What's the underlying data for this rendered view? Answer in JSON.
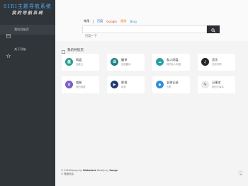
{
  "sidebar": {
    "logo_line1": "SIRI主题导航系统",
    "logo_line2": "我的导航系统",
    "items": [
      {
        "label": "我的导航页"
      },
      {
        "label": "关于导航"
      }
    ]
  },
  "search": {
    "tabs": [
      {
        "label": "常用",
        "color": "#333333"
      },
      {
        "label": "百度",
        "color": "#2d63de"
      },
      {
        "label": "Google",
        "color": "#d9534f"
      },
      {
        "label": "搜狗",
        "color": "#e8821c"
      },
      {
        "label": "Bing",
        "color": "#3ba0d8"
      }
    ],
    "placeholder": "百度一下",
    "button_icon": "search-icon"
  },
  "section": {
    "title": "我的导航页"
  },
  "cards": [
    {
      "title": "网盘",
      "desc": "百度云",
      "icon_color": "#2a9d8f",
      "glyph": "盘"
    },
    {
      "title": "翻译",
      "desc": "百度翻译",
      "icon_color": "#1f7f86",
      "glyph": "译"
    },
    {
      "title": "私人网盘",
      "desc": "我的私人网盘",
      "icon_color": "#26a0a8",
      "glyph": "☁"
    },
    {
      "title": "音乐",
      "desc": "在线听歌",
      "icon_color": "#252525",
      "glyph": "♫"
    },
    {
      "title": "相册",
      "desc": "我的相册",
      "icon_color": "#7b5cc4",
      "glyph": "✿"
    },
    {
      "title": "影视",
      "desc": "影视",
      "icon_color": "#1c3d6e",
      "glyph": "▶"
    },
    {
      "title": "长歌记录",
      "desc": "长歌",
      "icon_color": "#2f8fd8",
      "glyph": "◆"
    },
    {
      "title": "记事本",
      "desc": "我的记事本",
      "icon_color": "#e9e9e9",
      "glyph": "✎"
    }
  ],
  "footer": {
    "line1_prefix": "© 2020Design by",
    "line1_author": "Webstack",
    "line1_mid": "Modify by",
    "line1_modifier": "Songs",
    "line2": "© 备案信息"
  }
}
